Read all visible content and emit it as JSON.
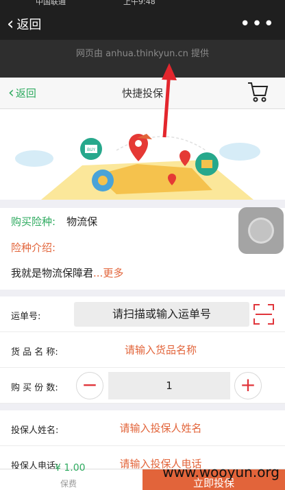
{
  "status_bar": {
    "carrier": "中国联通",
    "time": "上午9:48"
  },
  "wechat_bar": {
    "back_label": "返回",
    "more_label": "•••"
  },
  "provider_notice": "网页由 anhua.thinkyun.cn 提供",
  "nav": {
    "back_label": "返回",
    "title": "快捷投保"
  },
  "banner": {
    "tag_buy": "BUY"
  },
  "insurance": {
    "type_label": "购买险种:",
    "type_value": "物流保",
    "intro_label": "险种介绍:",
    "description": "我就是物流保障君",
    "more_link": "...更多"
  },
  "form": {
    "waybill_label": "运单号:",
    "waybill_placeholder": "请扫描或输入运单号",
    "goods_label": "货 品 名 称:",
    "goods_placeholder": "请输入货品名称",
    "quantity_label": "购 买 份 数:",
    "quantity_value": "1",
    "minus_label": "−",
    "plus_label": "+",
    "insured_name_label": "投保人姓名:",
    "insured_name_placeholder": "请输入投保人姓名",
    "insured_phone_label": "投保人电话:",
    "insured_phone_placeholder": "请输入投保人电话"
  },
  "bottom_bar": {
    "price": "¥ 1.00",
    "price_sub": "保费",
    "buy_label": "立即投保"
  },
  "watermark": "www.wooyun.org",
  "colors": {
    "accent_green": "#2eaa5f",
    "accent_orange": "#e2643a",
    "minus_red": "#e0343a",
    "annotation_red": "#e3262d"
  }
}
